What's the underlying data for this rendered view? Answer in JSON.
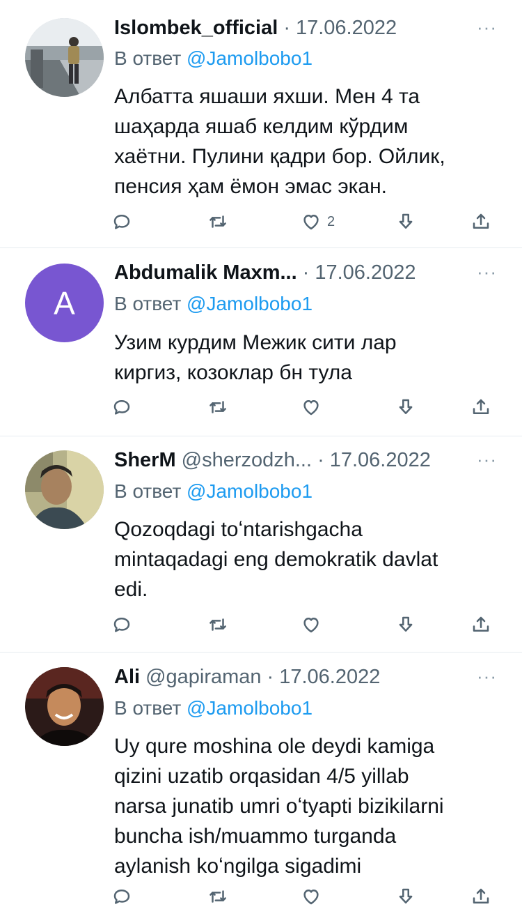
{
  "tweets": [
    {
      "name": "Islombek_official",
      "handle": "",
      "date": "17.06.2022",
      "reply_prefix": "В ответ",
      "reply_to": "@Jamolbobo1",
      "text": "Албатта яшаши яхши. Мен 4 та\nшаҳарда яшаб келдим кўрдим\nхаётни. Пулини қадри бор. Ойлик,\nпенсия ҳам ёмон эмас экан.",
      "likes": "2",
      "avatar": "photo"
    },
    {
      "name": "Abdumalik Maxm...",
      "handle": "",
      "date": "17.06.2022",
      "reply_prefix": "В ответ",
      "reply_to": "@Jamolbobo1",
      "text": "Узим курдим Межик сити лар\nкиргиз, козоклар бн тула",
      "likes": "",
      "avatar": "letter",
      "avatar_letter": "A",
      "avatar_color": "#7856d1"
    },
    {
      "name": "SherM",
      "handle": "@sherzodzh...",
      "date": "17.06.2022",
      "reply_prefix": "В ответ",
      "reply_to": "@Jamolbobo1",
      "text": "Qozoqdagi toʻntarishgacha\nmintaqadagi eng demokratik davlat\nedi.",
      "likes": "",
      "avatar": "photo"
    },
    {
      "name": "Ali",
      "handle": "@gapiraman",
      "date": "17.06.2022",
      "reply_prefix": "В ответ",
      "reply_to": "@Jamolbobo1",
      "text": "Uy qure moshina ole deydi kamiga\nqizini uzatib orqasidan 4/5 yillab\nnarsa junatib umri oʻtyapti bizikilarni\nbuncha ish/muammo turganda\naylanish koʻngilga sigadimi",
      "likes": "",
      "avatar": "photo"
    }
  ],
  "icons": {
    "reply": "reply-icon",
    "retweet": "retweet-icon",
    "like": "like-icon",
    "download": "download-icon",
    "share": "share-icon",
    "more": "more-icon"
  },
  "colors": {
    "link": "#1d9bf0",
    "secondary": "#536471",
    "divider": "#e6ecf0"
  }
}
